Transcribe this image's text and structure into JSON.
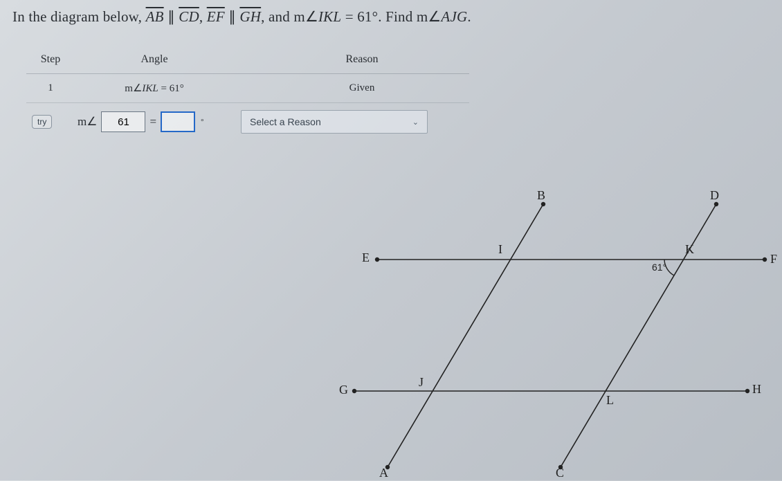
{
  "problem": {
    "prefix": "In the diagram below, ",
    "seg1": "AB",
    "parallel1": " ∥ ",
    "seg2": "CD",
    "comma1": ", ",
    "seg3": "EF",
    "parallel2": " ∥ ",
    "seg4": "GH",
    "comma2": ", and m",
    "ang_sym1": "∠",
    "ang1_name": "IKL",
    "eq1": " = 61°. Find m",
    "ang_sym2": "∠",
    "ang2_name": "AJG",
    "period": "."
  },
  "table": {
    "headers": {
      "step": "Step",
      "angle": "Angle",
      "reason": "Reason"
    },
    "row1": {
      "step": "1",
      "angle_prefix": "m",
      "angle_sym": "∠",
      "angle_name": "IKL",
      "angle_eq": " = 61°",
      "reason": "Given"
    },
    "input_row": {
      "try_label": "try",
      "m_prefix": "m",
      "angle_sym": "∠",
      "field1_value": "61",
      "equals": "=",
      "field2_value": "",
      "deg": "°",
      "reason_placeholder": "Select a Reason"
    }
  },
  "diagram": {
    "points": {
      "A": "A",
      "B": "B",
      "C": "C",
      "D": "D",
      "E": "E",
      "F": "F",
      "G": "G",
      "H": "H",
      "I": "I",
      "J": "J",
      "K": "K",
      "L": "L"
    },
    "given_angle": "61°"
  }
}
